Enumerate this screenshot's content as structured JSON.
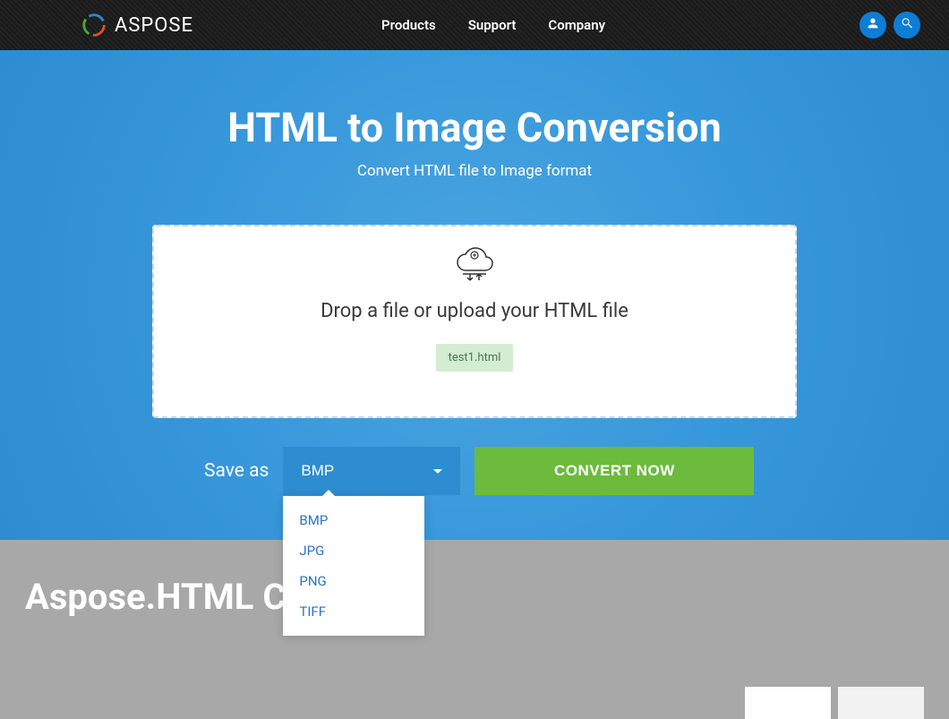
{
  "header": {
    "brand": "ASPOSE",
    "nav": [
      "Products",
      "Support",
      "Company"
    ]
  },
  "hero": {
    "title": "HTML to Image Conversion",
    "subtitle": "Convert HTML file to Image format"
  },
  "dropzone": {
    "prompt": "Drop a file or upload your HTML file",
    "file": "test1.html"
  },
  "controls": {
    "save_as_label": "Save as",
    "selected_format": "BMP",
    "formats": [
      "BMP",
      "JPG",
      "PNG",
      "TIFF"
    ],
    "convert_label": "CONVERT NOW"
  },
  "bottom": {
    "heading": "Aspose.HTML Con"
  }
}
